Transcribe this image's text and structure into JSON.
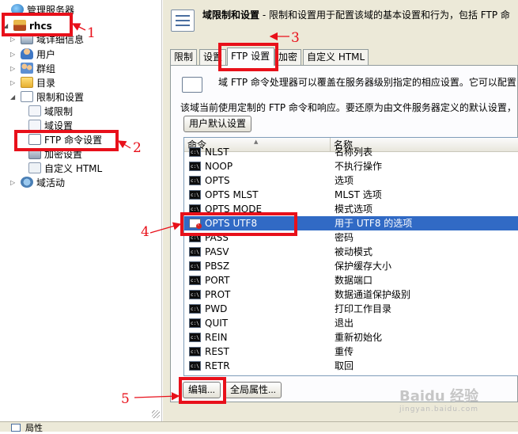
{
  "tree": {
    "items": [
      {
        "label": "管理服务器",
        "icon": "globe-icon"
      },
      {
        "label": "rhcs",
        "icon": "house-icon"
      },
      {
        "label": "域详细信息",
        "icon": "server-icon"
      },
      {
        "label": "用户",
        "icon": "user-icon"
      },
      {
        "label": "群组",
        "icon": "group-icon"
      },
      {
        "label": "目录",
        "icon": "folder-icon"
      },
      {
        "label": "限制和设置",
        "icon": "checklist-icon"
      },
      {
        "label": "域限制",
        "icon": "doc-icon"
      },
      {
        "label": "域设置",
        "icon": "doc-icon"
      },
      {
        "label": "FTP 命令设置",
        "icon": "command-icon"
      },
      {
        "label": "加密设置",
        "icon": "lock-icon"
      },
      {
        "label": "自定义 HTML",
        "icon": "html-icon"
      },
      {
        "label": "域活动",
        "icon": "activity-icon"
      }
    ]
  },
  "header": {
    "title": "域限制和设置",
    "description": " - 限制和设置用于配置该域的基本设置和行为，包括 FTP 命"
  },
  "tabs": [
    {
      "label": "限制"
    },
    {
      "label": "设置"
    },
    {
      "label": "FTP 设置"
    },
    {
      "label": "加密"
    },
    {
      "label": "自定义 HTML"
    }
  ],
  "page": {
    "info_text": "域 FTP 命令处理器可以覆盖在服务器级别指定的相应设置。它可以配置",
    "info_text2": "该域当前使用定制的 FTP 命令和响应。要还原为由文件服务器定义的默认设置，",
    "user_default_button": "用户默认设置"
  },
  "list": {
    "columns": [
      "命令",
      "名称"
    ],
    "rows": [
      {
        "cmd": "NLST",
        "desc": "名称列表"
      },
      {
        "cmd": "NOOP",
        "desc": "不执行操作"
      },
      {
        "cmd": "OPTS",
        "desc": "选项"
      },
      {
        "cmd": "OPTS MLST",
        "desc": "MLST 选项"
      },
      {
        "cmd": "OPTS MODE",
        "desc": "模式选项"
      },
      {
        "cmd": "OPTS UTF8",
        "desc": "用于 UTF8 的选项",
        "selected": true
      },
      {
        "cmd": "PASS",
        "desc": "密码"
      },
      {
        "cmd": "PASV",
        "desc": "被动模式"
      },
      {
        "cmd": "PBSZ",
        "desc": "保护缓存大小"
      },
      {
        "cmd": "PORT",
        "desc": "数据端口"
      },
      {
        "cmd": "PROT",
        "desc": "数据通道保护级别"
      },
      {
        "cmd": "PWD",
        "desc": "打印工作目录"
      },
      {
        "cmd": "QUIT",
        "desc": "退出"
      },
      {
        "cmd": "REIN",
        "desc": "重新初始化"
      },
      {
        "cmd": "REST",
        "desc": "重传"
      },
      {
        "cmd": "RETR",
        "desc": "取回"
      }
    ]
  },
  "buttons": {
    "edit": "编辑...",
    "global_props": "全局属性..."
  },
  "status": {
    "text": "局性"
  },
  "annotations": [
    "1",
    "2",
    "3",
    "4",
    "5"
  ],
  "watermark": {
    "brand": "Baidu 经验",
    "sub": "jingyan.baidu.com"
  },
  "colors": {
    "annotation": "#e8101a",
    "selection": "#316ac5",
    "dialog_bg": "#ece9d8"
  }
}
